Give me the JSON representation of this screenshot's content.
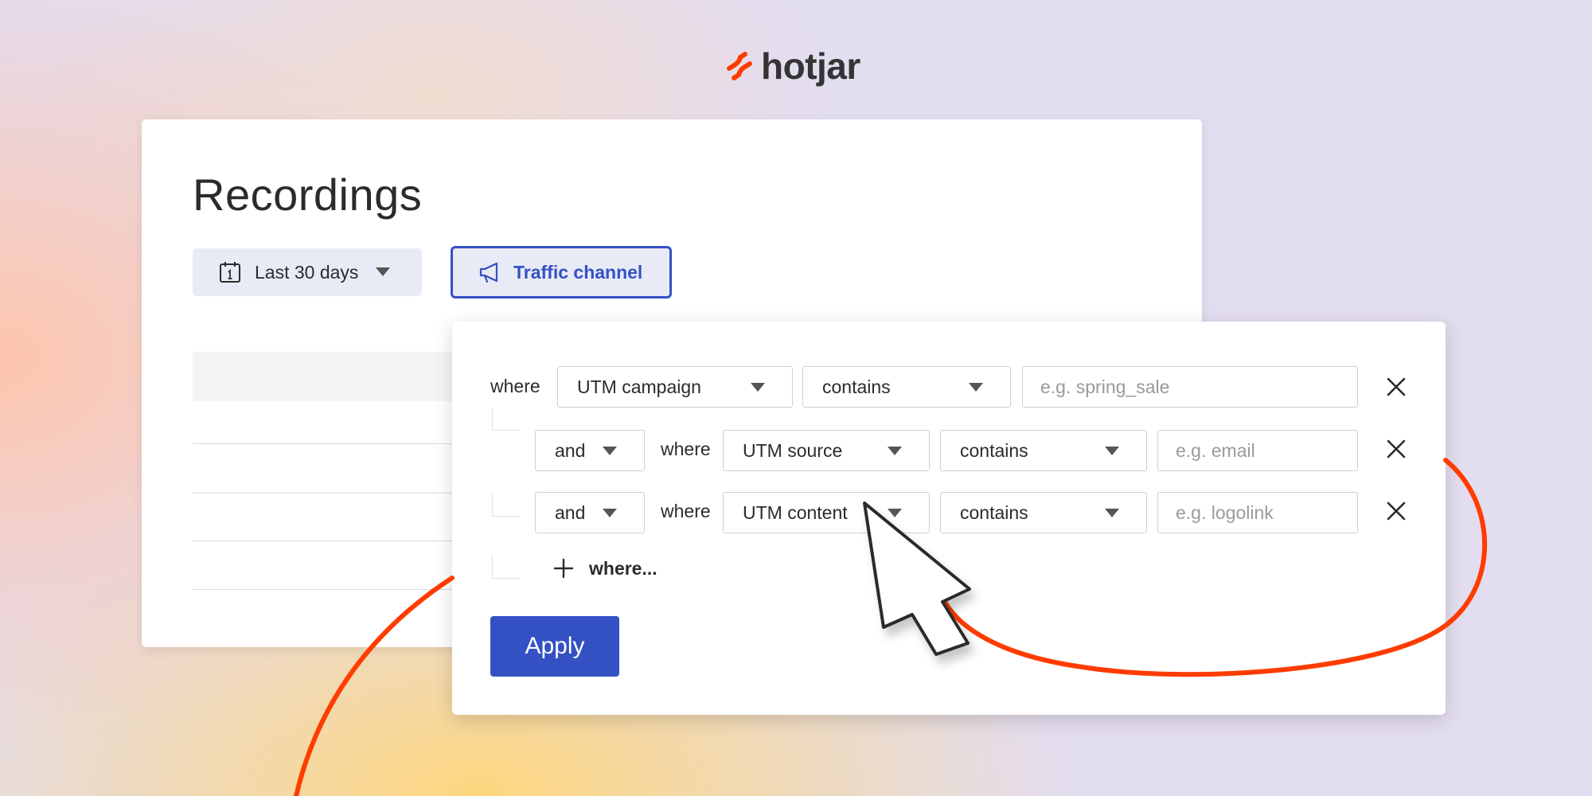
{
  "brand": {
    "name": "hotjar",
    "color": "#ff3c00"
  },
  "page": {
    "title": "Recordings"
  },
  "toolbar": {
    "date_range": {
      "label": "Last 30 days",
      "icon": "calendar-icon"
    },
    "traffic_channel": {
      "label": "Traffic channel",
      "icon": "megaphone-icon",
      "active": true
    }
  },
  "filter": {
    "rows": [
      {
        "connector": "",
        "where": "where",
        "field": "UTM campaign",
        "operator": "contains",
        "placeholder": "e.g. spring_sale"
      },
      {
        "connector": "and",
        "where": "where",
        "field": "UTM source",
        "operator": "contains",
        "placeholder": "e.g. email"
      },
      {
        "connector": "and",
        "where": "where",
        "field": "UTM content",
        "operator": "contains",
        "placeholder": "e.g. logolink"
      }
    ],
    "add_label": "where...",
    "apply_label": "Apply"
  },
  "colors": {
    "accent": "#3451c3",
    "accent_light": "#e8eaf6",
    "curve": "#ff3c00"
  }
}
